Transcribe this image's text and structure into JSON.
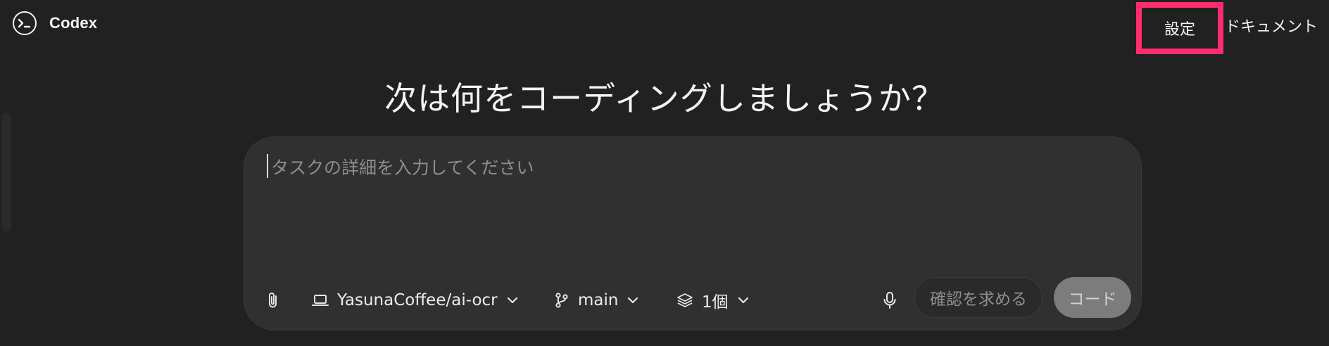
{
  "header": {
    "brand_name": "Codex",
    "nav_settings": "設定",
    "nav_docs": "ドキュメント"
  },
  "main": {
    "heading": "次は何をコーディングしましょうか？"
  },
  "composer": {
    "placeholder": "タスクの詳細を入力してください",
    "repo_label": "YasunaCoffee/ai-ocr",
    "branch_label": "main",
    "versions_label": "1個",
    "confirm_label": "確認を求める",
    "code_label": "コード"
  },
  "icons": {
    "brand": "terminal-logo-icon",
    "attach": "paperclip-icon",
    "repo": "laptop-icon",
    "branch": "git-branch-icon",
    "versions": "layers-icon",
    "mic": "microphone-icon",
    "chevron": "chevron-down-icon"
  },
  "colors": {
    "background": "#212121",
    "composer": "#303030",
    "highlight": "#ff2d6e",
    "code_button": "#7c7c7c"
  }
}
